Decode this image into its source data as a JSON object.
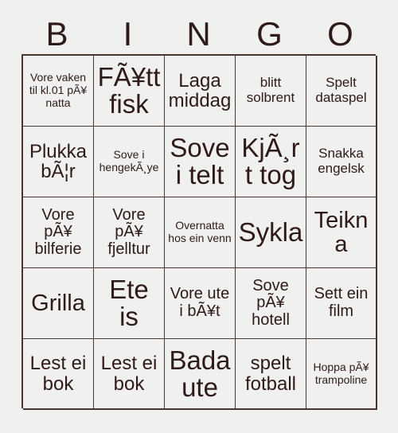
{
  "card": {
    "title_letters": [
      "B",
      "I",
      "N",
      "G",
      "O"
    ],
    "colors": {
      "background": "#f0f0ee",
      "border": "#4a3535",
      "text": "#2e1a1a"
    },
    "grid_size": "5x5",
    "rows": [
      [
        {
          "text": "Vore vaken til kl.01 pÃ¥ natta",
          "size": "fs-s"
        },
        {
          "text": "FÃ¥tt fisk",
          "size": "fs-huge"
        },
        {
          "text": "Laga middag",
          "size": "fs-xl"
        },
        {
          "text": "blitt solbrent",
          "size": "fs-m"
        },
        {
          "text": "Spelt dataspel",
          "size": "fs-m"
        }
      ],
      [
        {
          "text": "Plukka bÃ¦r",
          "size": "fs-xl"
        },
        {
          "text": "Sove i hengekÃ¸ye",
          "size": "fs-s"
        },
        {
          "text": "Sove i telt",
          "size": "fs-huge"
        },
        {
          "text": "KjÃ¸rt tog",
          "size": "fs-huge"
        },
        {
          "text": "Snakka engelsk",
          "size": "fs-m"
        }
      ],
      [
        {
          "text": "Vore pÃ¥ bilferie",
          "size": "fs-l"
        },
        {
          "text": "Vore pÃ¥ fjelltur",
          "size": "fs-l"
        },
        {
          "text": "Overnatta hos ein venn",
          "size": "fs-s"
        },
        {
          "text": "Sykla",
          "size": "fs-huge"
        },
        {
          "text": "Teikna",
          "size": "fs-xxl"
        }
      ],
      [
        {
          "text": "Grilla",
          "size": "fs-xxl"
        },
        {
          "text": "Ete is",
          "size": "fs-huge"
        },
        {
          "text": "Vore ute i bÃ¥t",
          "size": "fs-l"
        },
        {
          "text": "Sove pÃ¥ hotell",
          "size": "fs-l"
        },
        {
          "text": "Sett ein film",
          "size": "fs-l"
        }
      ],
      [
        {
          "text": "Lest ei bok",
          "size": "fs-xl"
        },
        {
          "text": "Lest ei bok",
          "size": "fs-xl"
        },
        {
          "text": "Bada ute",
          "size": "fs-huge"
        },
        {
          "text": "spelt fotball",
          "size": "fs-xl"
        },
        {
          "text": "Hoppa pÃ¥ trampoline",
          "size": "fs-s"
        }
      ]
    ]
  }
}
